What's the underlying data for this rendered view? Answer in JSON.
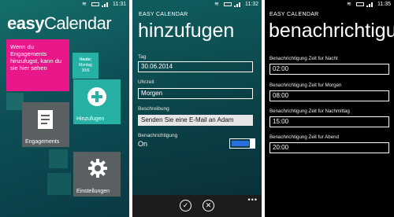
{
  "status": {
    "time1": "11:31",
    "time2": "11:32",
    "time3": "11:35"
  },
  "screen1": {
    "title_bold": "easy",
    "title_rest": "Calendar",
    "tile_engagements_text": "Wenn du Engagements hinzufugst, kann du sie hier sehen",
    "today_label": "Heute:",
    "today_day": "Montag",
    "today_date": "30/6",
    "add_label": "Hinzufugen",
    "engagements_label": "Engagements",
    "settings_label": "Einstellungen",
    "icons": [
      "plus-icon",
      "document-icon",
      "gear-icon"
    ],
    "accent_pink": "#e8188a",
    "accent_teal": "#27b1a5"
  },
  "screen2": {
    "app_name": "EASY CALENDAR",
    "page_title": "hinzufugen",
    "date_label": "Tag",
    "date_value": "30.06.2014",
    "time_label": "Uhrzeit",
    "time_value": "Morgen",
    "desc_label": "Beschreibung",
    "desc_value": "Senden Sie eine E-Mail an Adam",
    "notify_label": "Benachrichtigung",
    "notify_state": "On",
    "more": "•••"
  },
  "screen3": {
    "app_name": "EASY CALENDAR",
    "page_title": "benachrichtigu",
    "fields": [
      {
        "label": "Benachrichtigung Zeit fur Nacht",
        "value": "02:00"
      },
      {
        "label": "Benachrichtigung Zeit fur Morgen",
        "value": "08:00"
      },
      {
        "label": "Benachrichtigung Zeit fur Nachmittag",
        "value": "15:00"
      },
      {
        "label": "Benachrichtigung Zeit fur Abend",
        "value": "20:00"
      }
    ]
  }
}
